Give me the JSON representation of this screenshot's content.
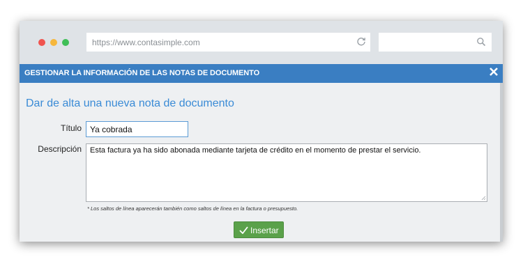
{
  "browser": {
    "url": "https://www.contasimple.com",
    "search_value": ""
  },
  "dialog": {
    "title": "GESTIONAR LA INFORMACIÓN DE LAS NOTAS DE DOCUMENTO",
    "heading": "Dar de alta una nueva nota de documento",
    "title_label": "Título",
    "title_value": "Ya cobrada",
    "description_label": "Descripción",
    "description_value": "Esta factura ya ha sido abonada mediante tarjeta de crédito en el momento de prestar el servicio.",
    "note": "* Los saltos de línea aparecerán también como saltos de línea en la factura o presupuesto.",
    "submit_label": "Insertar"
  },
  "icons": {
    "reload": "reload-icon",
    "search": "search-icon",
    "close": "close-icon",
    "check": "check-icon"
  },
  "colors": {
    "header_bar": "#3a7ec2",
    "heading": "#3a8bd6",
    "submit_button": "#5aa14a",
    "close_dot": "#f0544f",
    "minimize_dot": "#f6b73c",
    "maximize_dot": "#3fbf57"
  }
}
